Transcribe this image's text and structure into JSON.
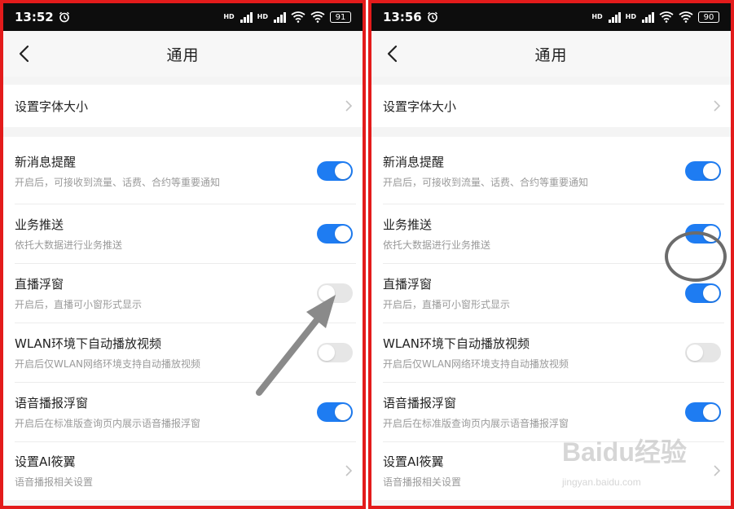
{
  "panels": [
    {
      "status": {
        "time": "13:52",
        "battery": "91"
      },
      "header": {
        "title": "通用"
      },
      "font_size_row": {
        "label": "设置字体大小"
      },
      "settings": [
        {
          "label": "新消息提醒",
          "sub": "开启后，可接收到流量、话费、合约等重要通知",
          "state": "on"
        },
        {
          "label": "业务推送",
          "sub": "依托大数据进行业务推送",
          "state": "on"
        },
        {
          "label": "直播浮窗",
          "sub": "开启后，直播可小窗形式显示",
          "state": "off"
        },
        {
          "label": "WLAN环境下自动播放视频",
          "sub": "开启后仅WLAN网络环境支持自动播放视频",
          "state": "off"
        },
        {
          "label": "语音播报浮窗",
          "sub": "开启后在标准版查询页内展示语音播报浮窗",
          "state": "on"
        }
      ],
      "ai_row": {
        "label": "设置AI筱翼",
        "sub": "语音播报相关设置"
      }
    },
    {
      "status": {
        "time": "13:56",
        "battery": "90"
      },
      "header": {
        "title": "通用"
      },
      "font_size_row": {
        "label": "设置字体大小"
      },
      "settings": [
        {
          "label": "新消息提醒",
          "sub": "开启后，可接收到流量、话费、合约等重要通知",
          "state": "on"
        },
        {
          "label": "业务推送",
          "sub": "依托大数据进行业务推送",
          "state": "on"
        },
        {
          "label": "直播浮窗",
          "sub": "开启后，直播可小窗形式显示",
          "state": "on"
        },
        {
          "label": "WLAN环境下自动播放视频",
          "sub": "开启后仅WLAN网络环境支持自动播放视频",
          "state": "off"
        },
        {
          "label": "语音播报浮窗",
          "sub": "开启后在标准版查询页内展示语音播报浮窗",
          "state": "on"
        }
      ],
      "ai_row": {
        "label": "设置AI筱翼",
        "sub": "语音播报相关设置"
      }
    }
  ],
  "watermark": {
    "logo_text": "Baidu经验",
    "url": "jingyan.baidu.com"
  },
  "colors": {
    "toggle_on": "#1e7cf2",
    "toggle_off": "#e6e6e6",
    "frame": "#e31b1b",
    "status_bar": "#0d0d0d"
  }
}
